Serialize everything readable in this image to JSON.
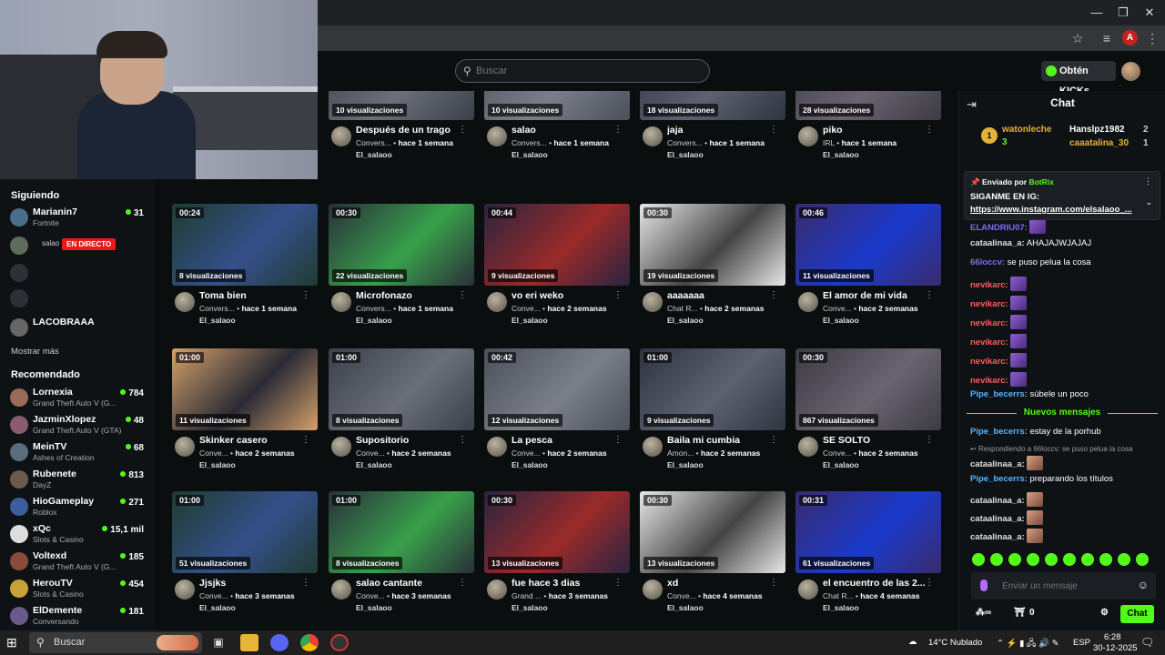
{
  "header": {
    "search_placeholder": "Buscar",
    "kicks_label": "Obtén KICKs"
  },
  "sidebar": {
    "following_title": "Siguiendo",
    "following": [
      {
        "name": "Marianin7",
        "game": "Fortnite",
        "count": "31",
        "color": "#4a6d8c"
      },
      {
        "name": "salao",
        "badge": "EN DIRECTO",
        "color": "#5d6b5b"
      },
      {
        "name": "",
        "game": "",
        "color": "#556"
      },
      {
        "name": "",
        "game": "",
        "color": "#556"
      },
      {
        "name": "LACOBRAAA",
        "game": "",
        "color": "#666"
      }
    ],
    "show_more": "Mostrar más",
    "recommended_title": "Recomendado",
    "recommended": [
      {
        "name": "Lornexia",
        "game": "Grand Theft Auto V (G...",
        "count": "784",
        "color": "#9b6b5a"
      },
      {
        "name": "JazminXlopez",
        "game": "Grand Theft Auto V (GTA)",
        "count": "48",
        "color": "#8a5c6e"
      },
      {
        "name": "MeinTV",
        "game": "Ashes of Creation",
        "count": "68",
        "color": "#5a6d7c"
      },
      {
        "name": "Rubenete",
        "game": "DayZ",
        "count": "813",
        "color": "#6d5a4a"
      },
      {
        "name": "HioGameplay",
        "game": "Roblox",
        "count": "271",
        "color": "#3a5f9c"
      },
      {
        "name": "xQc",
        "game": "Slots & Casino",
        "count": "15,1 mil",
        "color": "#ddd"
      },
      {
        "name": "Voltexd",
        "game": "Grand Theft Auto V (G...",
        "count": "185",
        "color": "#8c4a3a"
      },
      {
        "name": "HerouTV",
        "game": "Slots & Casino",
        "count": "454",
        "color": "#c9a13a"
      },
      {
        "name": "ElDemente",
        "game": "Conversando",
        "count": "181",
        "color": "#6a5a8c"
      }
    ]
  },
  "clips": [
    {
      "views": "10 visualizaciones",
      "title": "Después de un trago",
      "cat": "Convers...",
      "age": "hace 1 semana",
      "channel": "El_salaoo"
    },
    {
      "views": "10 visualizaciones",
      "title": "salao",
      "cat": "Convers...",
      "age": "hace 1 semana",
      "channel": "El_salaoo"
    },
    {
      "views": "18 visualizaciones",
      "title": "jaja",
      "cat": "Convers...",
      "age": "hace 1 semana",
      "channel": "El_salaoo"
    },
    {
      "views": "28 visualizaciones",
      "title": "piko",
      "cat": "IRL",
      "age": "hace 1 semana",
      "channel": "El_salaoo"
    },
    {
      "duration": "00:24",
      "views": "8 visualizaciones",
      "title": "Toma bien",
      "cat": "Convers...",
      "age": "hace 1 semana",
      "channel": "El_salaoo"
    },
    {
      "duration": "00:30",
      "views": "22 visualizaciones",
      "title": "Microfonazo",
      "cat": "Convers...",
      "age": "hace 1 semana",
      "channel": "El_salaoo"
    },
    {
      "duration": "00:44",
      "views": "9 visualizaciones",
      "title": "vo eri weko",
      "cat": "Conve...",
      "age": "hace 2 semanas",
      "channel": "El_salaoo"
    },
    {
      "duration": "00:30",
      "views": "19 visualizaciones",
      "title": "aaaaaaa",
      "cat": "Chat R...",
      "age": "hace 2 semanas",
      "channel": "El_salaoo"
    },
    {
      "duration": "00:46",
      "views": "11 visualizaciones",
      "title": "El amor de mi vida",
      "cat": "Conve...",
      "age": "hace 2 semanas",
      "channel": "El_salaoo"
    },
    {
      "duration": "01:00",
      "views": "11 visualizaciones",
      "title": "Skinker casero",
      "cat": "Conve...",
      "age": "hace 2 semanas",
      "channel": "El_salaoo"
    },
    {
      "duration": "01:00",
      "views": "8 visualizaciones",
      "title": "Supositorio",
      "cat": "Conve...",
      "age": "hace 2 semanas",
      "channel": "El_salaoo"
    },
    {
      "duration": "00:42",
      "views": "12 visualizaciones",
      "title": "La pesca",
      "cat": "Conve...",
      "age": "hace 2 semanas",
      "channel": "El_salaoo"
    },
    {
      "duration": "01:00",
      "views": "9 visualizaciones",
      "title": "Baila mi cumbia",
      "cat": "Amon...",
      "age": "hace 2 semanas",
      "channel": "El_salaoo"
    },
    {
      "duration": "00:30",
      "views": "867 visualizaciones",
      "title": "SE SOLTO",
      "cat": "Conve...",
      "age": "hace 2 semanas",
      "channel": "El_salaoo"
    },
    {
      "duration": "01:00",
      "views": "51 visualizaciones",
      "title": "Jjsjks",
      "cat": "Conve...",
      "age": "hace 3 semanas",
      "channel": "El_salaoo"
    },
    {
      "duration": "01:00",
      "views": "8 visualizaciones",
      "title": "salao cantante",
      "cat": "Conve...",
      "age": "hace 3 semanas",
      "channel": "El_salaoo"
    },
    {
      "duration": "00:30",
      "views": "13 visualizaciones",
      "title": "fue hace 3 dias",
      "cat": "Grand ...",
      "age": "hace 3 semanas",
      "channel": "El_salaoo"
    },
    {
      "duration": "00:30",
      "views": "13 visualizaciones",
      "title": "xd",
      "cat": "Conve...",
      "age": "hace 4 semanas",
      "channel": "El_salaoo"
    },
    {
      "duration": "00:31",
      "views": "61 visualizaciones",
      "title": "el encuentro de las 2...",
      "cat": "Chat R...",
      "age": "hace 4 semanas",
      "channel": "El_salaoo"
    }
  ],
  "chat": {
    "title": "Chat",
    "leaders": [
      {
        "rank": "1",
        "name": "watonleche",
        "count": "3"
      },
      {
        "name": "Hanslpz1982",
        "count": "2"
      },
      {
        "name": "caaatalina_30",
        "count": "1"
      }
    ],
    "pinned_by_prefix": "Enviado por",
    "pinned_by": "BotRix",
    "pinned_msg": "SIGANME EN IG:",
    "pinned_link": "https://www.instagram.com/elsalaoo_...",
    "messages": [
      {
        "user": "ELANDRIU07:",
        "text": "",
        "emote": true,
        "color": "#7c6cff"
      },
      {
        "user": "cataalinaa_a:",
        "text": "AHAJAJWJAJAJ",
        "color": "#e0e0e0"
      },
      {
        "user": "66loccv:",
        "text": "se puso pelua la cosa",
        "color": "#7c6cff"
      },
      {
        "user": "nevikarc:",
        "text": "",
        "emote": true,
        "color": "#ff5c5c"
      },
      {
        "user": "nevikarc:",
        "text": "",
        "emote": true,
        "color": "#ff5c5c"
      },
      {
        "user": "nevikarc:",
        "text": "",
        "emote": true,
        "color": "#ff5c5c"
      },
      {
        "user": "nevikarc:",
        "text": "",
        "emote": true,
        "color": "#ff5c5c"
      },
      {
        "user": "nevikarc:",
        "text": "",
        "emote": true,
        "color": "#ff5c5c"
      },
      {
        "user": "nevikarc:",
        "text": "",
        "emote": true,
        "color": "#ff5c5c"
      },
      {
        "user": "Pipe_becerrs:",
        "text": "súbele un poco",
        "color": "#5ab4ff"
      }
    ],
    "new_messages": "Nuevos mensajes",
    "messages2": [
      {
        "user": "Pipe_becerrs:",
        "text": "estay de la porhub",
        "color": "#5ab4ff"
      },
      {
        "user": "cataalinaa_a:",
        "text": "",
        "emote": true,
        "face": true,
        "color": "#e0e0e0"
      },
      {
        "user": "Pipe_becerrs:",
        "text": "preparando los títulos",
        "color": "#5ab4ff"
      },
      {
        "user": "cataalinaa_a:",
        "text": "",
        "emote": true,
        "face": true,
        "color": "#e0e0e0"
      },
      {
        "user": "cataalinaa_a:",
        "text": "",
        "emote": true,
        "face": true,
        "color": "#e0e0e0"
      },
      {
        "user": "cataalinaa_a:",
        "text": "",
        "emote": true,
        "face": true,
        "color": "#e0e0e0"
      }
    ],
    "reply_note": "Respondiendo a 66loccv: se puso pelua la cosa",
    "input_placeholder": "Enviar un mensaje",
    "points": "0",
    "send_label": "Chat"
  },
  "taskbar": {
    "search": "Buscar",
    "weather": "14°C  Nublado",
    "lang": "ESP",
    "time": "6:28",
    "date": "30-12-2025"
  }
}
